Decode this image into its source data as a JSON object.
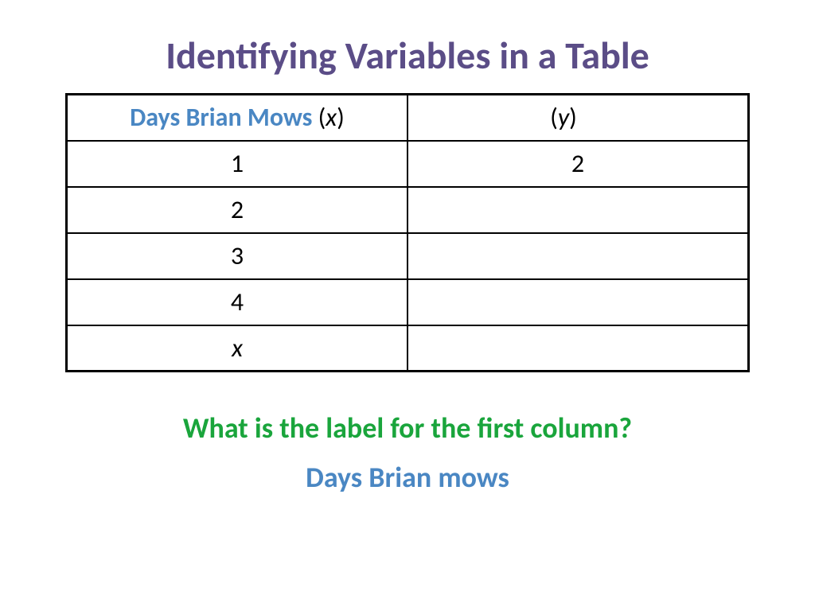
{
  "title": "Identifying Variables in a Table",
  "table": {
    "header": {
      "left_label": "Days Brian Mows",
      "left_var": "x",
      "right_label": "",
      "right_var": "y"
    },
    "rows": [
      {
        "x": "1",
        "y": "2"
      },
      {
        "x": "2",
        "y": ""
      },
      {
        "x": "3",
        "y": ""
      },
      {
        "x": "4",
        "y": ""
      },
      {
        "x": "x",
        "y": ""
      }
    ]
  },
  "question": "What is the label for the first column?",
  "answer": "Days Brian mows"
}
